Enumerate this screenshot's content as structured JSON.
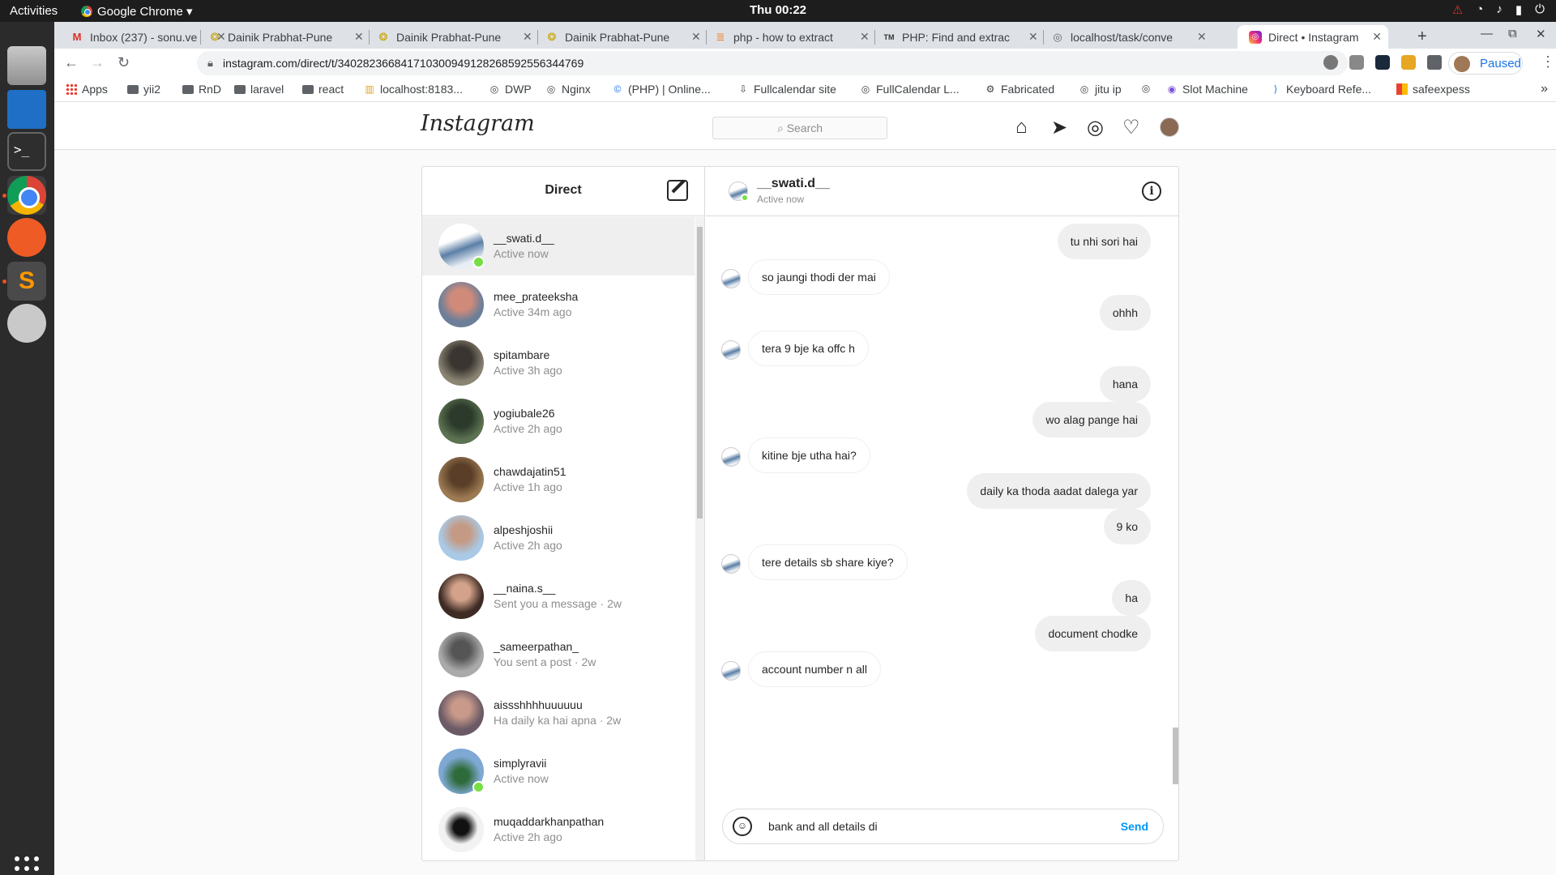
{
  "os": {
    "activities": "Activities",
    "app_menu": "Google Chrome ▾",
    "clock": "Thu 00:22",
    "tray": [
      "⚠",
      "wifi",
      "volume",
      "battery",
      "power"
    ]
  },
  "browser": {
    "tabs": [
      {
        "title": "Inbox (237) - sonu.ve",
        "icon": "gmail-icon"
      },
      {
        "title": "Dainik Prabhat-Pune",
        "icon": "newspaper-icon"
      },
      {
        "title": "Dainik Prabhat-Pune",
        "icon": "newspaper-icon"
      },
      {
        "title": "Dainik Prabhat-Pune",
        "icon": "newspaper-icon"
      },
      {
        "title": "php - how to extract",
        "icon": "stackoverflow-icon"
      },
      {
        "title": "PHP: Find and extrac",
        "icon": "tm-icon"
      },
      {
        "title": "localhost/task/conve",
        "icon": "globe-icon"
      },
      {
        "title": "Direct • Instagram",
        "icon": "instagram-icon"
      }
    ],
    "url": "instagram.com/direct/t/340282366841710300949128268592556344769",
    "profile_label": "Paused",
    "bookmarks": [
      "Apps",
      "yii2",
      "RnD",
      "laravel",
      "react",
      "localhost:8183...",
      "DWP",
      "Nginx",
      "(PHP) | Online...",
      "Fullcalendar site",
      "FullCalendar L...",
      "Fabricated",
      "jitu ip",
      "",
      "Slot Machine",
      "Keyboard Refe...",
      "safeexpess"
    ]
  },
  "instagram": {
    "logo": "Instagram",
    "search_placeholder": "Search",
    "direct_title": "Direct",
    "threads": [
      {
        "name": "__swati.d__",
        "sub": "Active now",
        "online": true,
        "avatar": "#9db4d4"
      },
      {
        "name": "mee_prateeksha",
        "sub": "Active 34m ago",
        "online": false,
        "avatar": "#c28b7a"
      },
      {
        "name": "spitambare",
        "sub": "Active 3h ago",
        "online": false,
        "avatar": "#6f6a5c"
      },
      {
        "name": "yogiubale26",
        "sub": "Active 2h ago",
        "online": false,
        "avatar": "#3d4a3a"
      },
      {
        "name": "chawdajatin51",
        "sub": "Active 1h ago",
        "online": false,
        "avatar": "#7a5a3e"
      },
      {
        "name": "alpeshjoshii",
        "sub": "Active 2h ago",
        "online": false,
        "avatar": "#8fb7d8"
      },
      {
        "name": "__naina.s__",
        "sub": "Sent you a message · 2w",
        "online": false,
        "avatar": "#5a4238"
      },
      {
        "name": "_sameerpathan_",
        "sub": "You sent a post · 2w",
        "online": false,
        "avatar": "#7b7b7b"
      },
      {
        "name": "aissshhhhuuuuuu",
        "sub": "Ha daily ka hai apna · 2w",
        "online": false,
        "avatar": "#b08aa0"
      },
      {
        "name": "simplyravii",
        "sub": "Active now",
        "online": true,
        "avatar": "#6c8fb5"
      },
      {
        "name": "muqaddarkhanpathan",
        "sub": "Active 2h ago",
        "online": false,
        "avatar": "#e8e8e8"
      }
    ],
    "chat": {
      "name": "__swati.d__",
      "status": "Active now",
      "messages": [
        {
          "text": "tu nhi sori hai",
          "dir": "out"
        },
        {
          "text": "so jaungi thodi der mai",
          "dir": "in"
        },
        {
          "text": "ohhh",
          "dir": "out"
        },
        {
          "text": "tera 9 bje ka offc h",
          "dir": "in"
        },
        {
          "text": "hana",
          "dir": "out"
        },
        {
          "text": "wo alag pange hai",
          "dir": "out"
        },
        {
          "text": "kitine bje utha hai?",
          "dir": "in"
        },
        {
          "text": "daily ka thoda aadat dalega yar",
          "dir": "out"
        },
        {
          "text": "9 ko",
          "dir": "out"
        },
        {
          "text": "tere details sb share kiye?",
          "dir": "in"
        },
        {
          "text": "ha",
          "dir": "out"
        },
        {
          "text": "document chodke",
          "dir": "out"
        },
        {
          "text": "account number n all",
          "dir": "in"
        }
      ],
      "draft": "bank and all details di",
      "send_label": "Send"
    }
  }
}
